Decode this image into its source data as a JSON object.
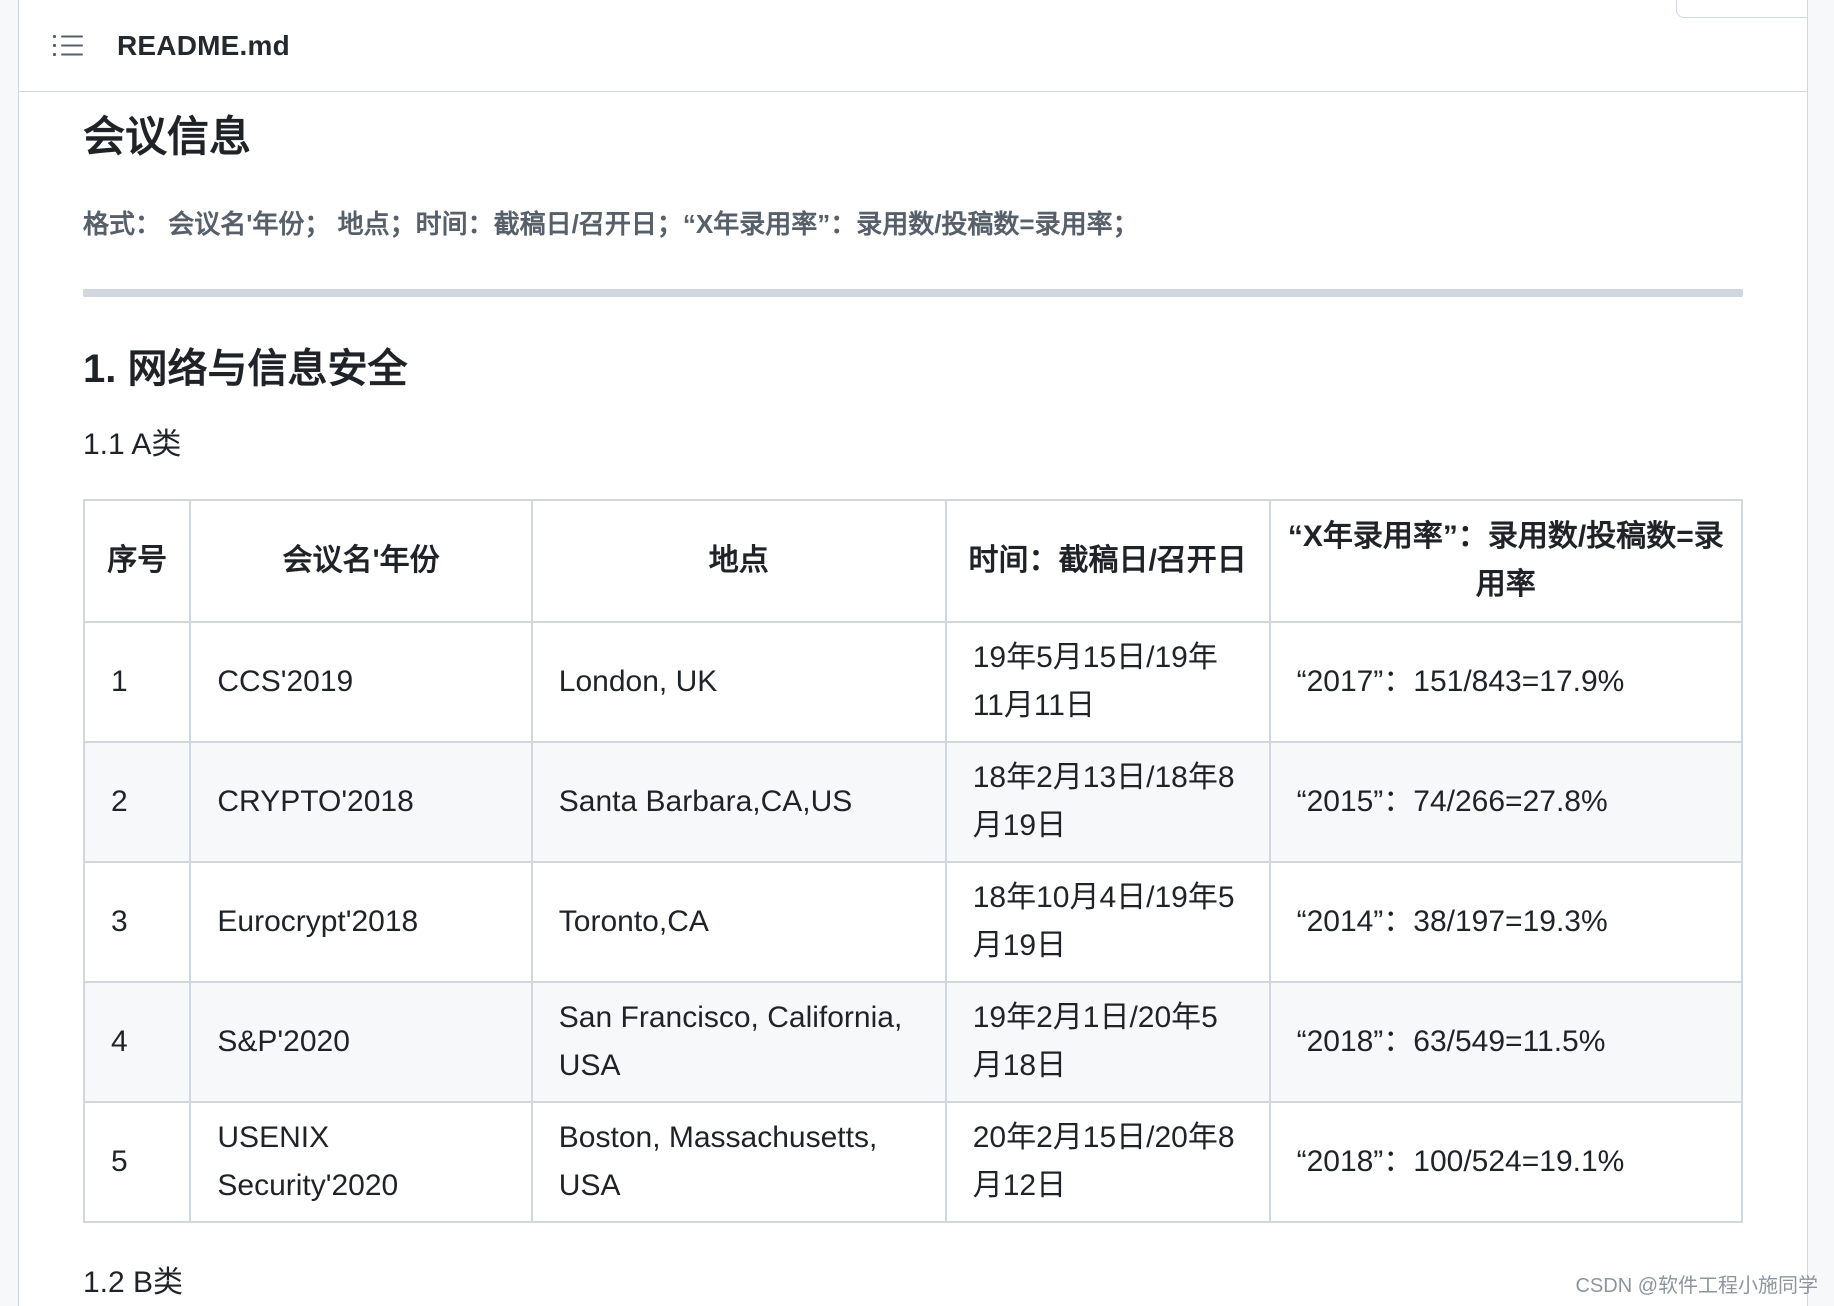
{
  "header": {
    "file_name": "README.md",
    "outline_icon": "list-unordered-icon"
  },
  "doc": {
    "title": "会议信息",
    "format_line": "格式： 会议名'年份； 地点；时间：截稿日/召开日；“X年录用率”：录用数/投稿数=录用率；",
    "section_heading": "1. 网络与信息安全",
    "subsection_a": "1.1 A类",
    "subsection_b": "1.2 B类"
  },
  "table": {
    "headers": [
      "序号",
      "会议名'年份",
      "地点",
      "时间：截稿日/召开日",
      "“X年录用率”：录用数/投稿数=录用率"
    ],
    "rows": [
      [
        "1",
        "CCS'2019",
        "London, UK",
        "19年5月15日/19年11月11日",
        "“2017”：151/843=17.9%"
      ],
      [
        "2",
        "CRYPTO'2018",
        "Santa Barbara,CA,US",
        "18年2月13日/18年8月19日",
        "“2015”：74/266=27.8%"
      ],
      [
        "3",
        "Eurocrypt'2018",
        "Toronto,CA",
        "18年10月4日/19年5月19日",
        "“2014”：38/197=19.3%"
      ],
      [
        "4",
        "S&P'2020",
        "San Francisco, California, USA",
        "19年2月1日/20年5月18日",
        "“2018”：63/549=11.5%"
      ],
      [
        "5",
        "USENIX Security'2020",
        "Boston, Massachusetts, USA",
        "20年2月15日/20年8月12日",
        "“2018”：100/524=19.1%"
      ]
    ]
  },
  "watermark": "CSDN @软件工程小施同学"
}
